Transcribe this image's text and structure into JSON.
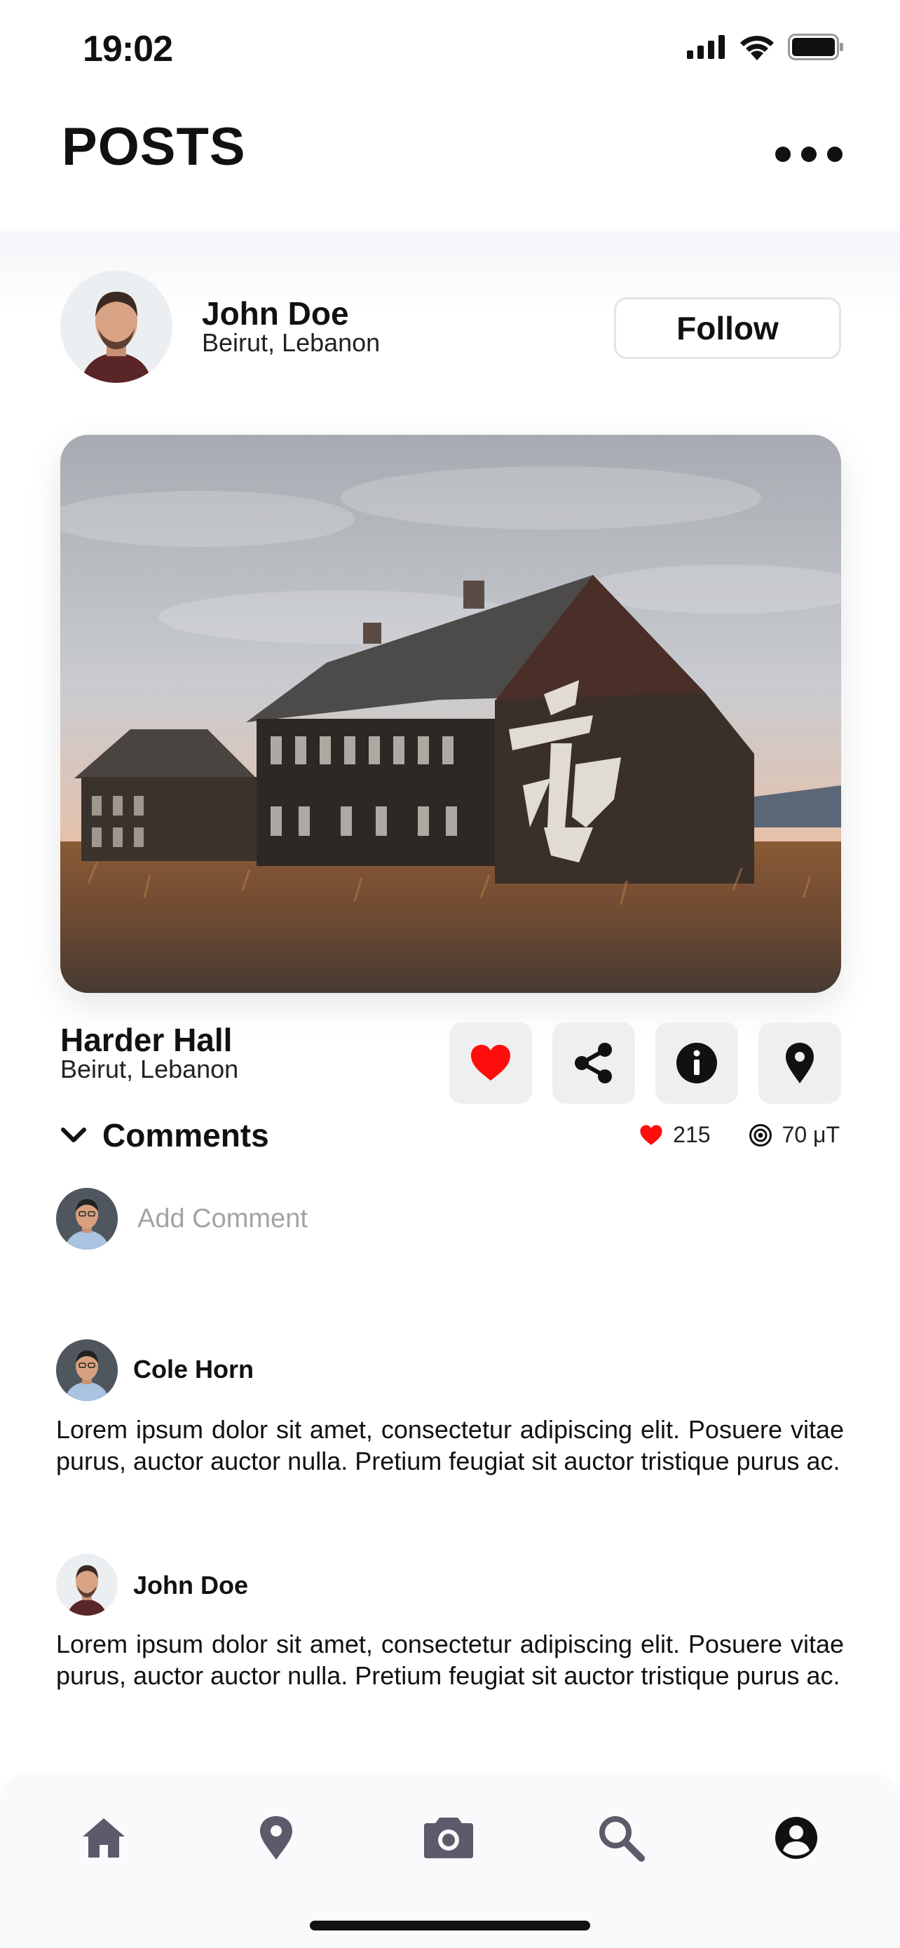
{
  "status_bar": {
    "time": "19:02"
  },
  "header": {
    "title": "POSTS"
  },
  "author": {
    "name": "John Doe",
    "location": "Beirut, Lebanon",
    "follow_label": "Follow"
  },
  "post": {
    "title": "Harder Hall",
    "location": "Beirut, Lebanon",
    "likes": "215",
    "radiation": "70 μT",
    "actions": [
      "heart-icon",
      "share-icon",
      "info-icon",
      "location-pin-icon"
    ]
  },
  "comments": {
    "label": "Comments",
    "input_placeholder": "Add Comment",
    "items": [
      {
        "author": "Cole Horn",
        "text": "Lorem ipsum dolor sit amet, consectetur adipiscing elit. Posuere vitae purus, auctor auctor nulla. Pretium feugiat sit auctor tristique purus ac."
      },
      {
        "author": "John Doe",
        "text": "Lorem ipsum dolor sit amet, consectetur adipiscing elit. Posuere vitae purus, auctor auctor nulla. Pretium feugiat sit auctor tristique purus ac."
      }
    ]
  },
  "nav": {
    "items": [
      "home-icon",
      "map-pin-icon",
      "camera-icon",
      "search-icon",
      "profile-icon"
    ],
    "active": "profile-icon"
  },
  "colors": {
    "accent_red": "#ff0d0d",
    "nav_inactive": "#5d5a6b",
    "text": "#111111"
  }
}
